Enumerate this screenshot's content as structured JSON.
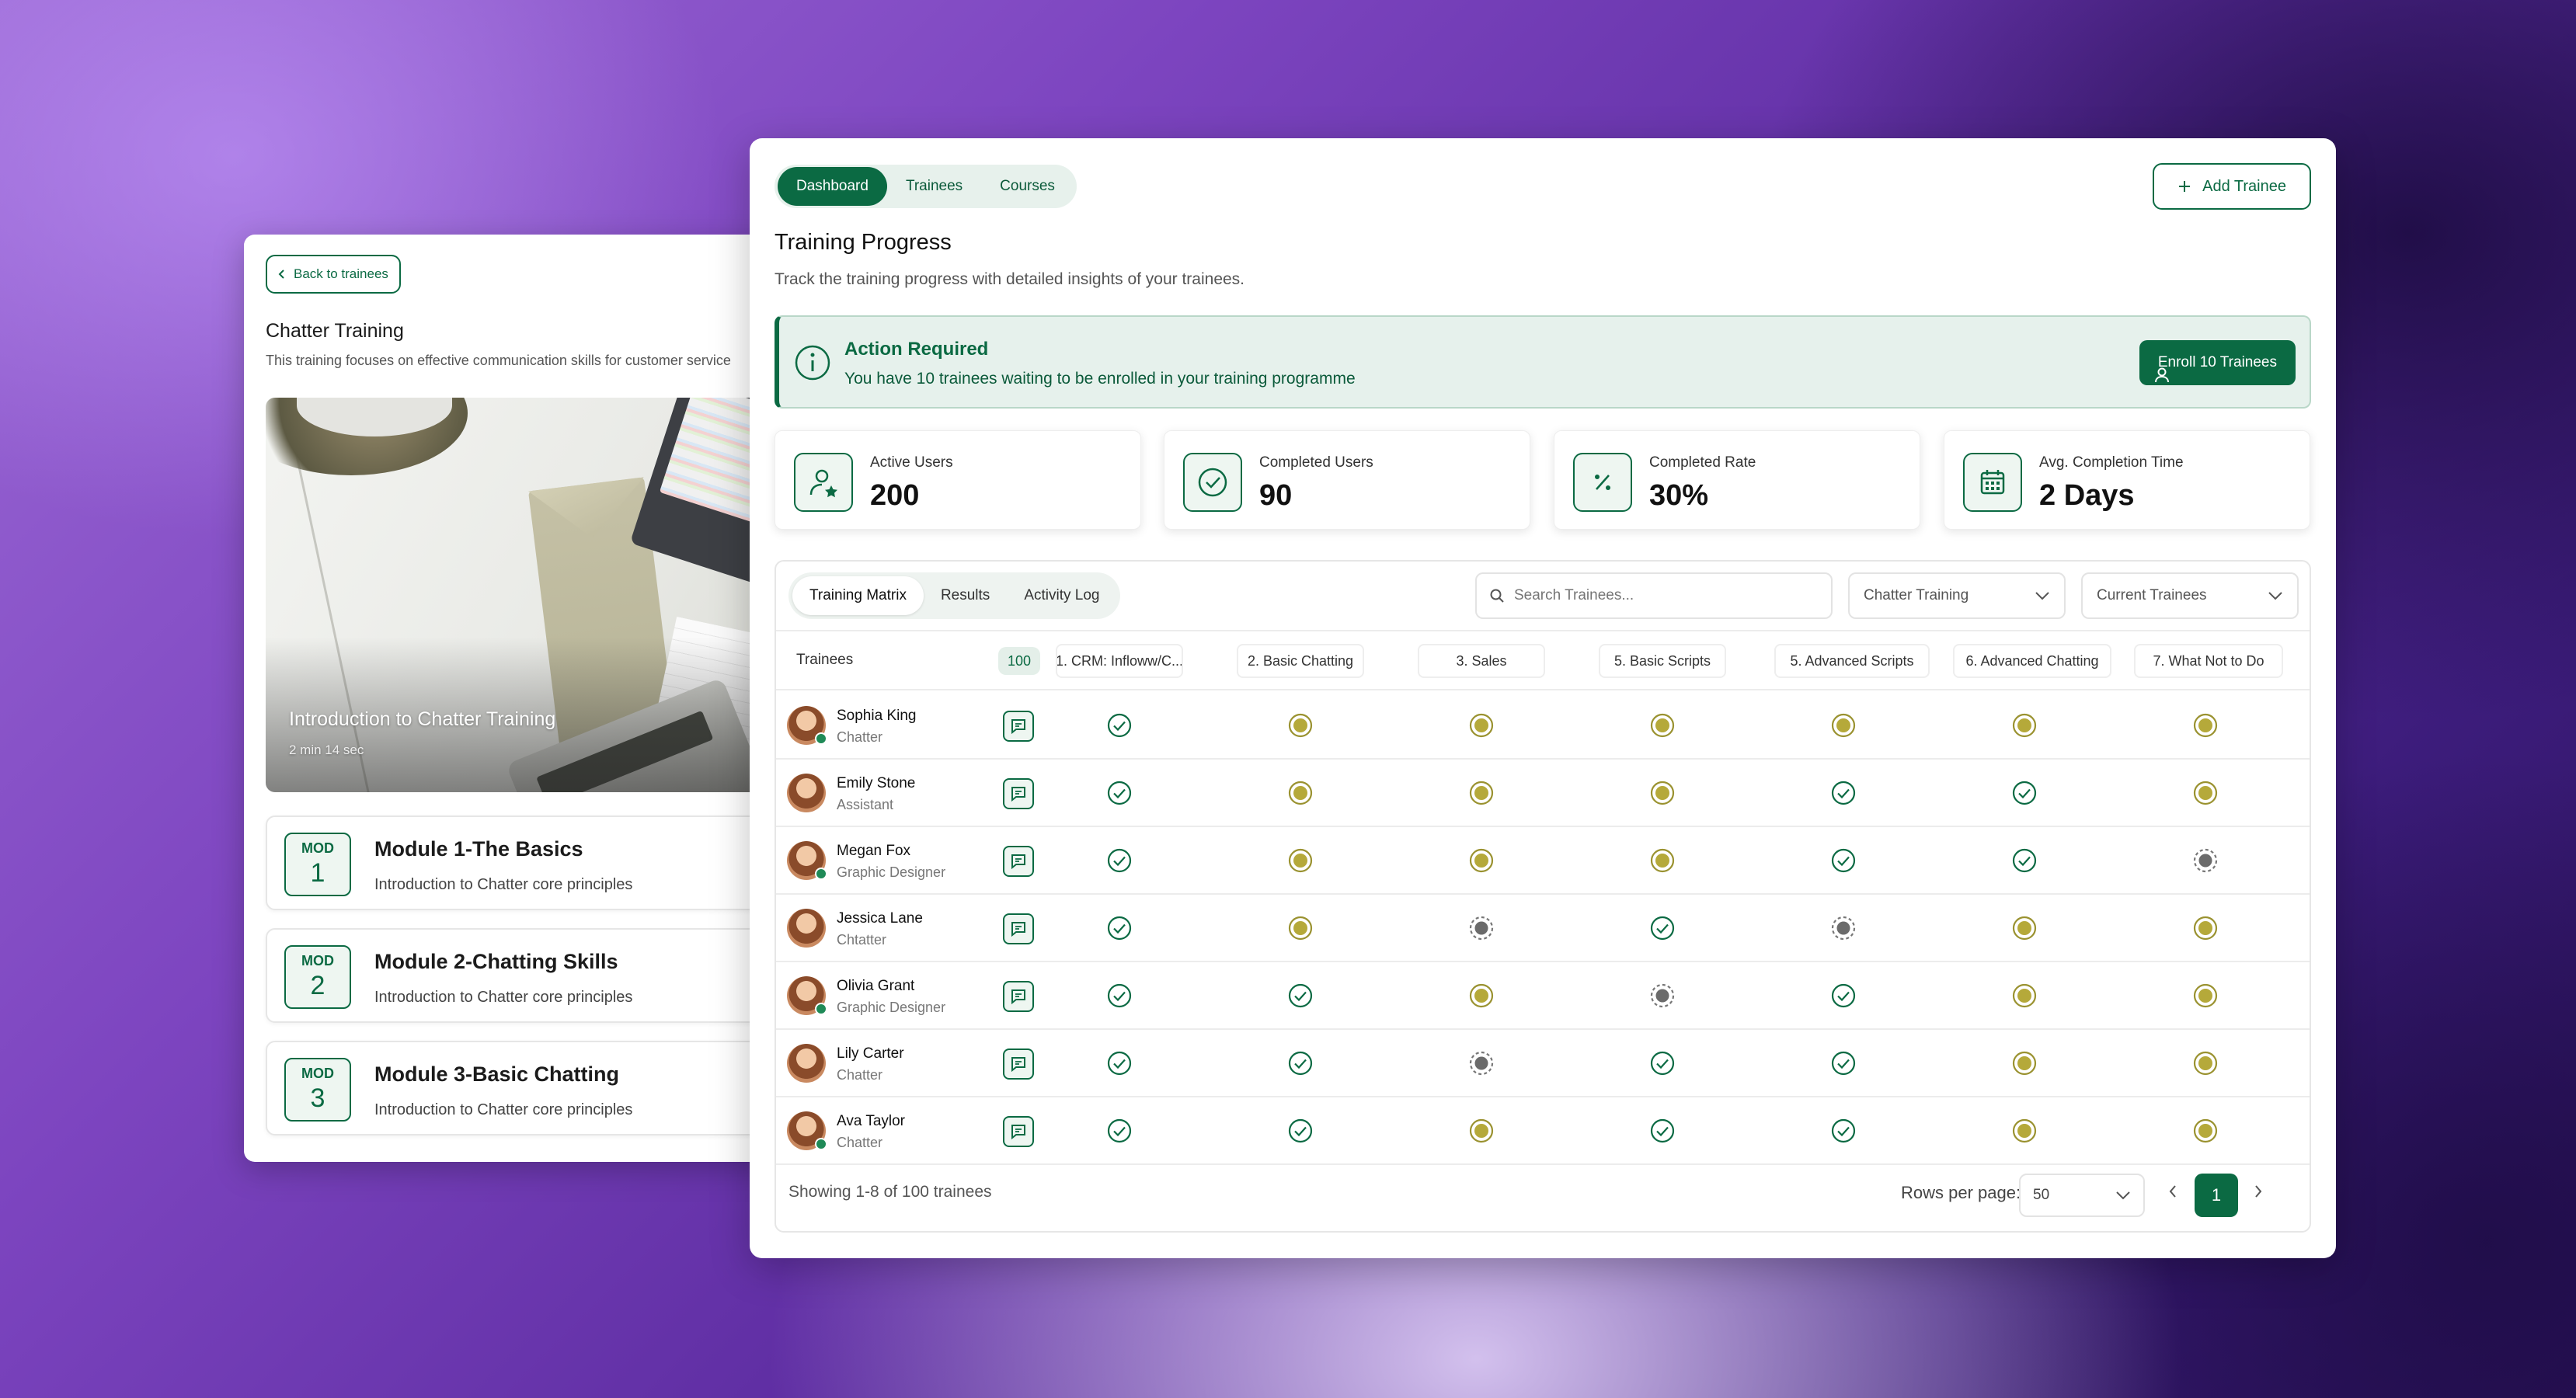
{
  "colors": {
    "accent": "#0b6a43",
    "in_progress": "#b5a93a",
    "not_started": "#6b6b6b"
  },
  "course_panel": {
    "back_label": "Back to trainees",
    "title": "Chatter Training",
    "description": "This training focuses on effective communication skills for customer service",
    "video": {
      "title": "Introduction to Chatter Training",
      "duration": "2 min 14 sec"
    },
    "modules": [
      {
        "tag": "MOD",
        "number": "1",
        "title": "Module 1-The Basics",
        "description": "Introduction to Chatter core principles"
      },
      {
        "tag": "MOD",
        "number": "2",
        "title": "Module 2-Chatting Skills",
        "description": "Introduction to Chatter core principles"
      },
      {
        "tag": "MOD",
        "number": "3",
        "title": "Module 3-Basic Chatting",
        "description": "Introduction to Chatter core principles"
      }
    ]
  },
  "nav": {
    "tabs": [
      "Dashboard",
      "Trainees",
      "Courses"
    ],
    "active": "Dashboard",
    "add_label": "Add Trainee"
  },
  "header": {
    "title": "Training Progress",
    "subtitle": "Track the training progress with detailed insights of your trainees."
  },
  "alert": {
    "title": "Action Required",
    "text": "You have 10 trainees waiting to be enrolled in your training programme",
    "button": "Enroll 10 Trainees"
  },
  "stats": [
    {
      "label": "Active Users",
      "value": "200",
      "icon": "user-star-icon"
    },
    {
      "label": "Completed Users",
      "value": "90",
      "icon": "check-circle-icon"
    },
    {
      "label": "Completed Rate",
      "value": "30%",
      "icon": "percent-icon"
    },
    {
      "label": "Avg. Completion Time",
      "value": "2 Days",
      "icon": "calendar-icon"
    }
  ],
  "matrix": {
    "tabs": [
      "Training Matrix",
      "Results",
      "Activity Log"
    ],
    "active_tab": "Training Matrix",
    "search_placeholder": "Search Trainees...",
    "course_filter": "Chatter Training",
    "status_filter": "Current Trainees",
    "trainees_header": "Trainees",
    "trainees_count": "100",
    "columns": [
      "1. CRM: Infloww/C...",
      "2. Basic Chatting",
      "3. Sales",
      "5. Basic Scripts",
      "5. Advanced Scripts",
      "6. Advanced Chatting",
      "7. What Not to Do"
    ],
    "rows": [
      {
        "name": "Sophia King",
        "role": "Chatter",
        "online": true,
        "status": [
          "done",
          "progress",
          "progress",
          "progress",
          "progress",
          "progress",
          "progress"
        ]
      },
      {
        "name": "Emily Stone",
        "role": "Assistant",
        "online": false,
        "status": [
          "done",
          "progress",
          "progress",
          "progress",
          "done",
          "done",
          "progress"
        ]
      },
      {
        "name": "Megan Fox",
        "role": "Graphic Designer",
        "online": true,
        "status": [
          "done",
          "progress",
          "progress",
          "progress",
          "done",
          "done",
          "pending"
        ]
      },
      {
        "name": "Jessica Lane",
        "role": "Chtatter",
        "online": false,
        "status": [
          "done",
          "progress",
          "pending",
          "done",
          "pending",
          "progress",
          "progress"
        ]
      },
      {
        "name": "Olivia Grant",
        "role": "Graphic Designer",
        "online": true,
        "status": [
          "done",
          "done",
          "progress",
          "pending",
          "done",
          "progress",
          "progress"
        ]
      },
      {
        "name": "Lily Carter",
        "role": "Chatter",
        "online": false,
        "status": [
          "done",
          "done",
          "pending",
          "done",
          "done",
          "progress",
          "progress"
        ]
      },
      {
        "name": "Ava Taylor",
        "role": "Chatter",
        "online": true,
        "status": [
          "done",
          "done",
          "progress",
          "done",
          "done",
          "progress",
          "progress"
        ]
      }
    ],
    "footer": {
      "showing": "Showing 1-8 of 100 trainees",
      "rows_per_page_label": "Rows per page:",
      "rows_per_page": "50",
      "current_page": "1"
    }
  }
}
